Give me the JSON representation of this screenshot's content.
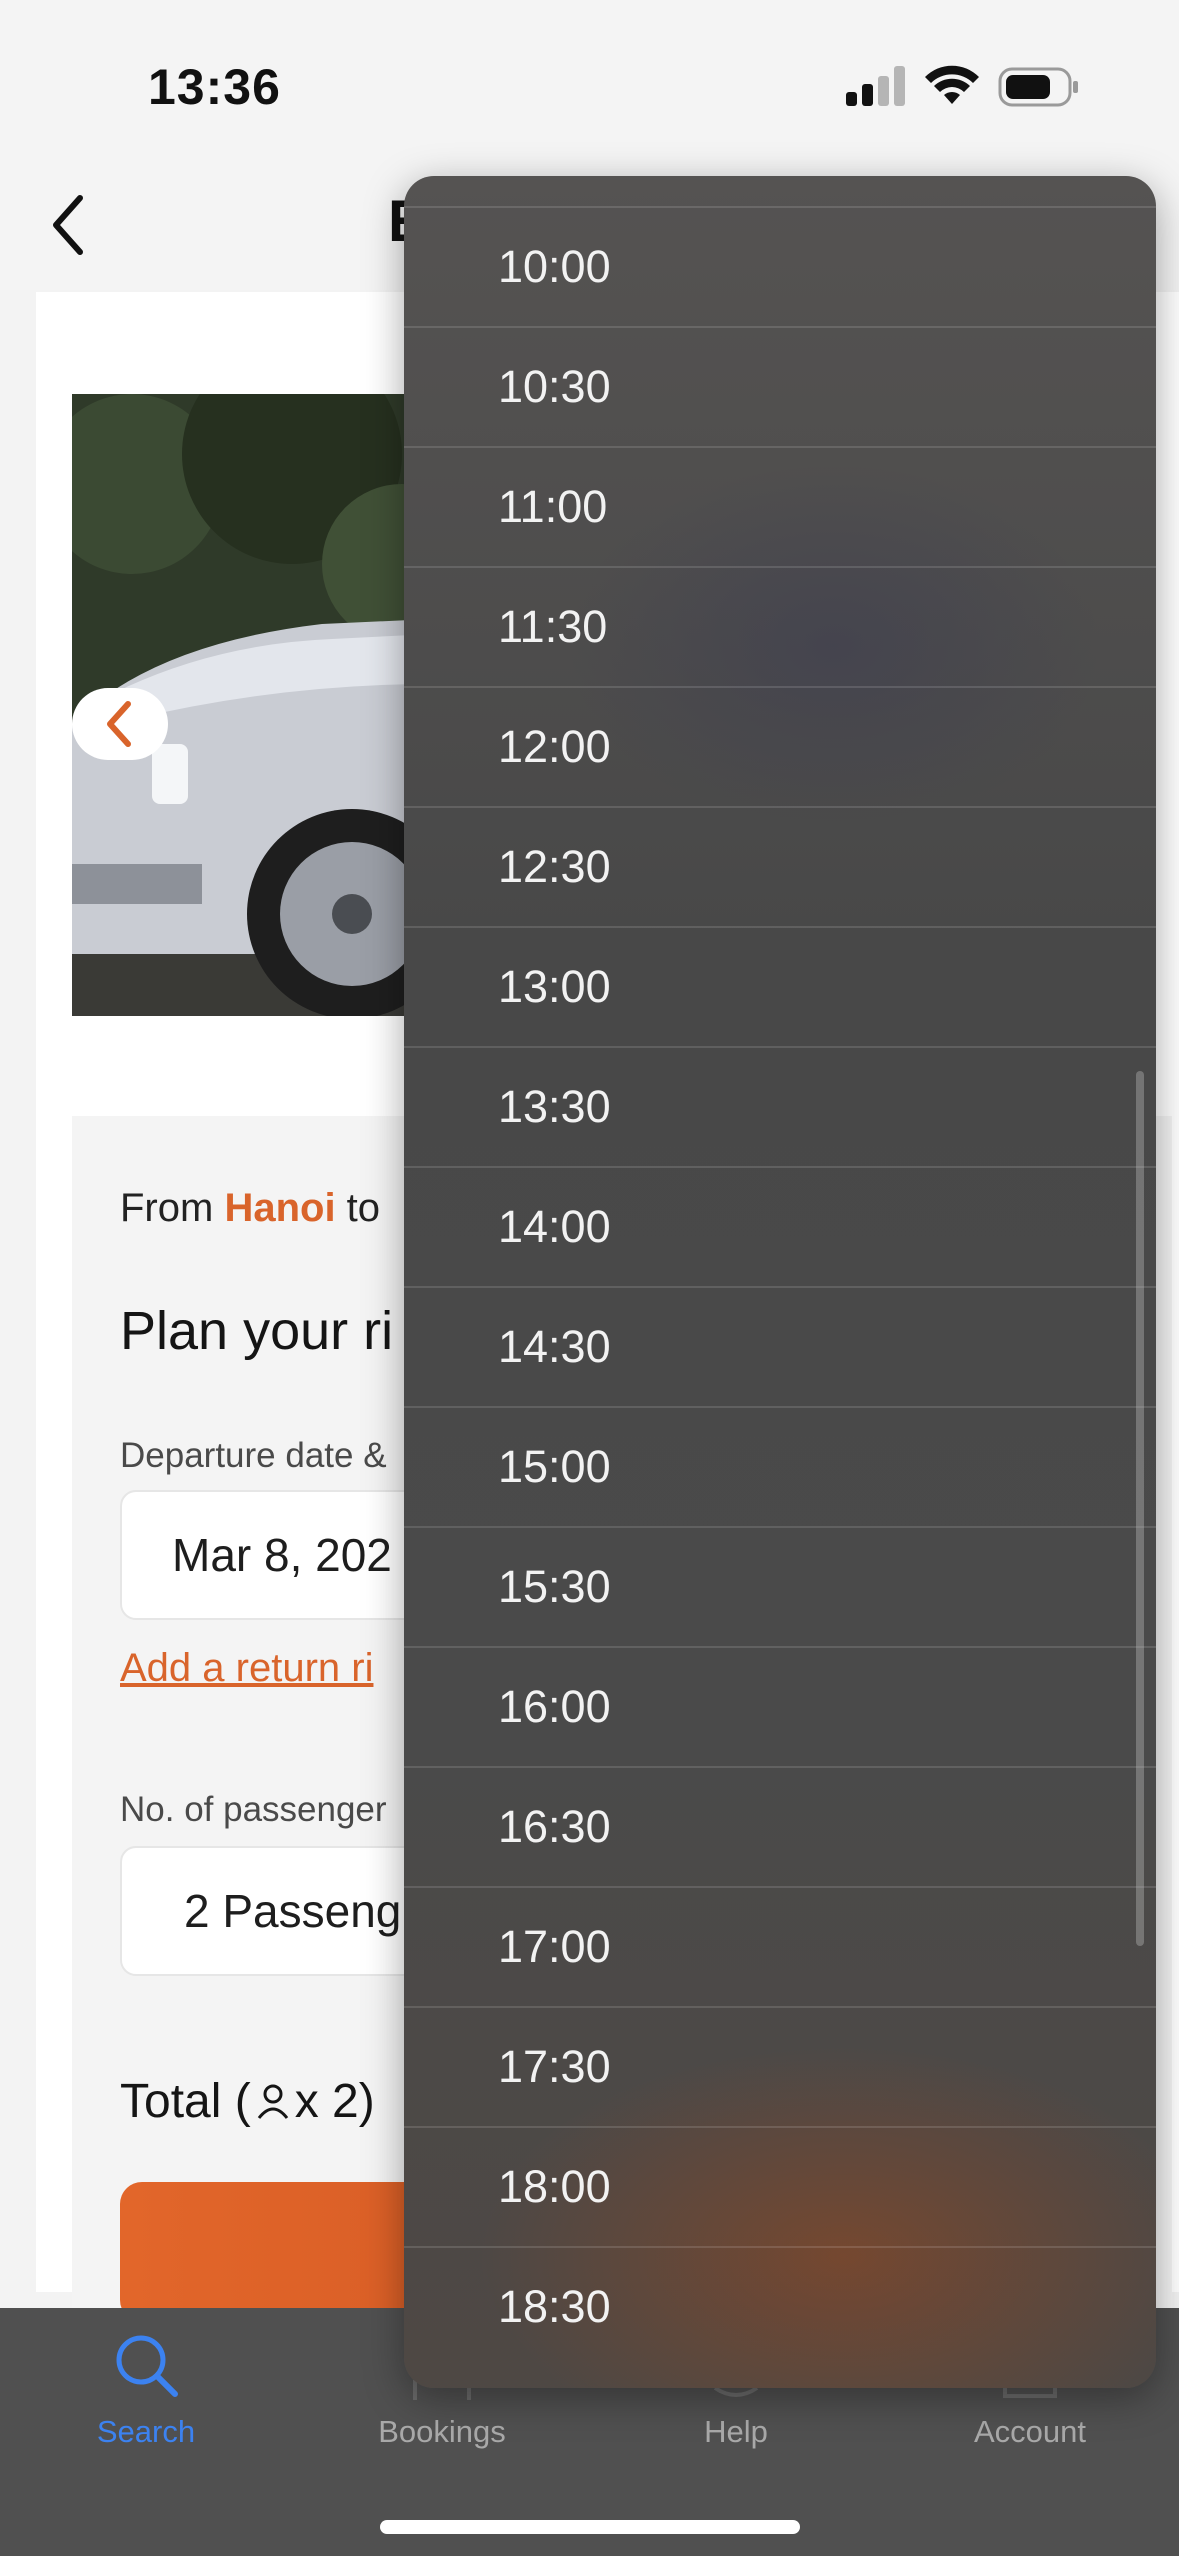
{
  "status_bar": {
    "time": "13:36"
  },
  "header": {
    "title": "E"
  },
  "trip": {
    "route_prefix": "From ",
    "origin": "Hanoi",
    "route_mid": " to",
    "plan_title": "Plan your ri",
    "departure_label": "Departure date &",
    "departure_value": "Mar 8, 202",
    "return_link": "Add a return ri",
    "passengers_label": "No. of passenger",
    "passengers_value": "2 Passeng",
    "total_prefix": "Total (",
    "total_suffix": " x 2)"
  },
  "time_menu": {
    "items": [
      "10:00",
      "10:30",
      "11:00",
      "11:30",
      "12:00",
      "12:30",
      "13:00",
      "13:30",
      "14:00",
      "14:30",
      "15:00",
      "15:30",
      "16:00",
      "16:30",
      "17:00",
      "17:30",
      "18:00",
      "18:30"
    ]
  },
  "tab_bar": {
    "tabs": [
      {
        "label": "Search",
        "icon": "search-icon",
        "active": true
      },
      {
        "label": "Bookings",
        "icon": "bookings-icon",
        "active": false
      },
      {
        "label": "Help",
        "icon": "help-icon",
        "active": false
      },
      {
        "label": "Account",
        "icon": "account-icon",
        "active": false
      }
    ]
  },
  "colors": {
    "accent": "#d9642b",
    "tab_active": "#3c82f0",
    "menu_bg": "#4a4a4a"
  }
}
